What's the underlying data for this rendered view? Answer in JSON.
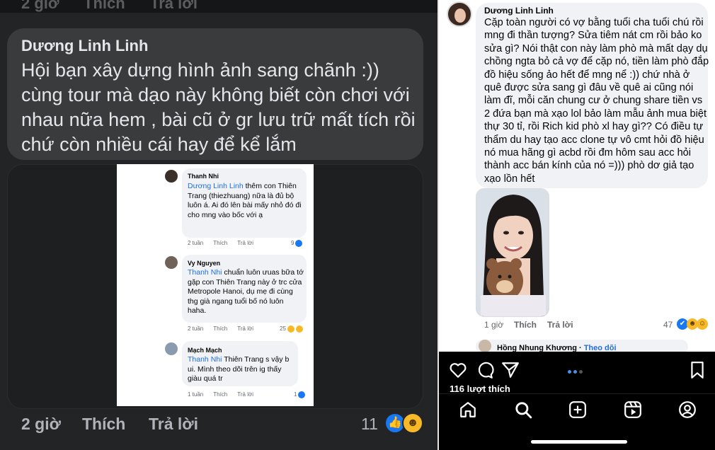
{
  "left": {
    "top_strip": [
      "2 giờ",
      "Thích",
      "Trả lời"
    ],
    "comment": {
      "author": "Dương Linh Linh",
      "text": "Hội bạn xây dựng hình ảnh sang chãnh :)) cùng tour mà dạo này không biết còn chơi với nhau nữa hem , bài cũ ở gr lưu trữ mất tích rồi chứ còn nhiều cái hay để kể lắm",
      "time": "2 giờ",
      "like_label": "Thích",
      "reply_label": "Trả lời",
      "reaction_count": "11"
    },
    "screenshot": {
      "comments": [
        {
          "author": "Thanh Nhi",
          "tag": "Dương Linh Linh",
          "text": "thêm con Thiên Trang (thiezhuang) nữa là đủ bộ luôn á. Ai đó lên bài mấy nhỏ đó đi cho mng vào bốc với ạ",
          "time": "2 tuần",
          "like": "Thích",
          "reply": "Trả lời",
          "count": "9"
        },
        {
          "author": "Vy Nguyen",
          "tag": "Thanh Nhi",
          "text": "chuẩn luôn ưuas bữa tớ gặp con Thiên Trang này ở trc cửa Metropole Hanoi, dụ mẹ đi cùng thg già ngang tuổi bố nó luôn haha.",
          "time": "2 tuần",
          "like": "Thích",
          "reply": "Trả lời",
          "count": "25"
        },
        {
          "author": "Mạch Mạch",
          "tag": "Thanh Nhi",
          "text": "Thiên Trang s vậy b ui. Mình theo dõi trên ig thấy giàu quá tr",
          "time": "1 tuần",
          "like": "Thích",
          "reply": "Trả lời",
          "count": "1"
        }
      ]
    }
  },
  "right": {
    "comment": {
      "author": "Dương Linh Linh",
      "text": "Cặp toàn người có vợ bằng tuổi cha tuổi chú rồi mng đi thần tượng? Sửa tiêm nát cm rồi bảo ko sửa gì? Nói thật con này làm phò mà mất dạy dụ chồng ngta bỏ cả vợ để cặp nó, tiền làm phò đắp đồ hiệu sống ảo hết để mng nể :)) chứ nhà ở quê được sửa sang gì đâu về quê ai cũng nói làm đĩ, mỗi căn chung cư ở chung share tiền vs 2 đứa bạn mà xạo lol bảo làm mẫu ảnh mua biệt thự 30 tỉ, rồi Rich kid phò xl hay gì?? Có điều tự thẩm du hay tạo acc clone tự vô cmt hỏi đồ hiệu nó mua hãng gì acbd rồi đm hôm sau acc hỏi thành acc bán kính của nó =))) phò dơ giả tạo xạo lồn hết",
      "time": "1 giờ",
      "like_label": "Thích",
      "reply_label": "Trả lời",
      "reaction_count": "47"
    },
    "next_comment": {
      "author": "Hồng Nhung Khương",
      "follow": "Theo dõi"
    },
    "instagram": {
      "likes": "116 lượt thích"
    }
  }
}
